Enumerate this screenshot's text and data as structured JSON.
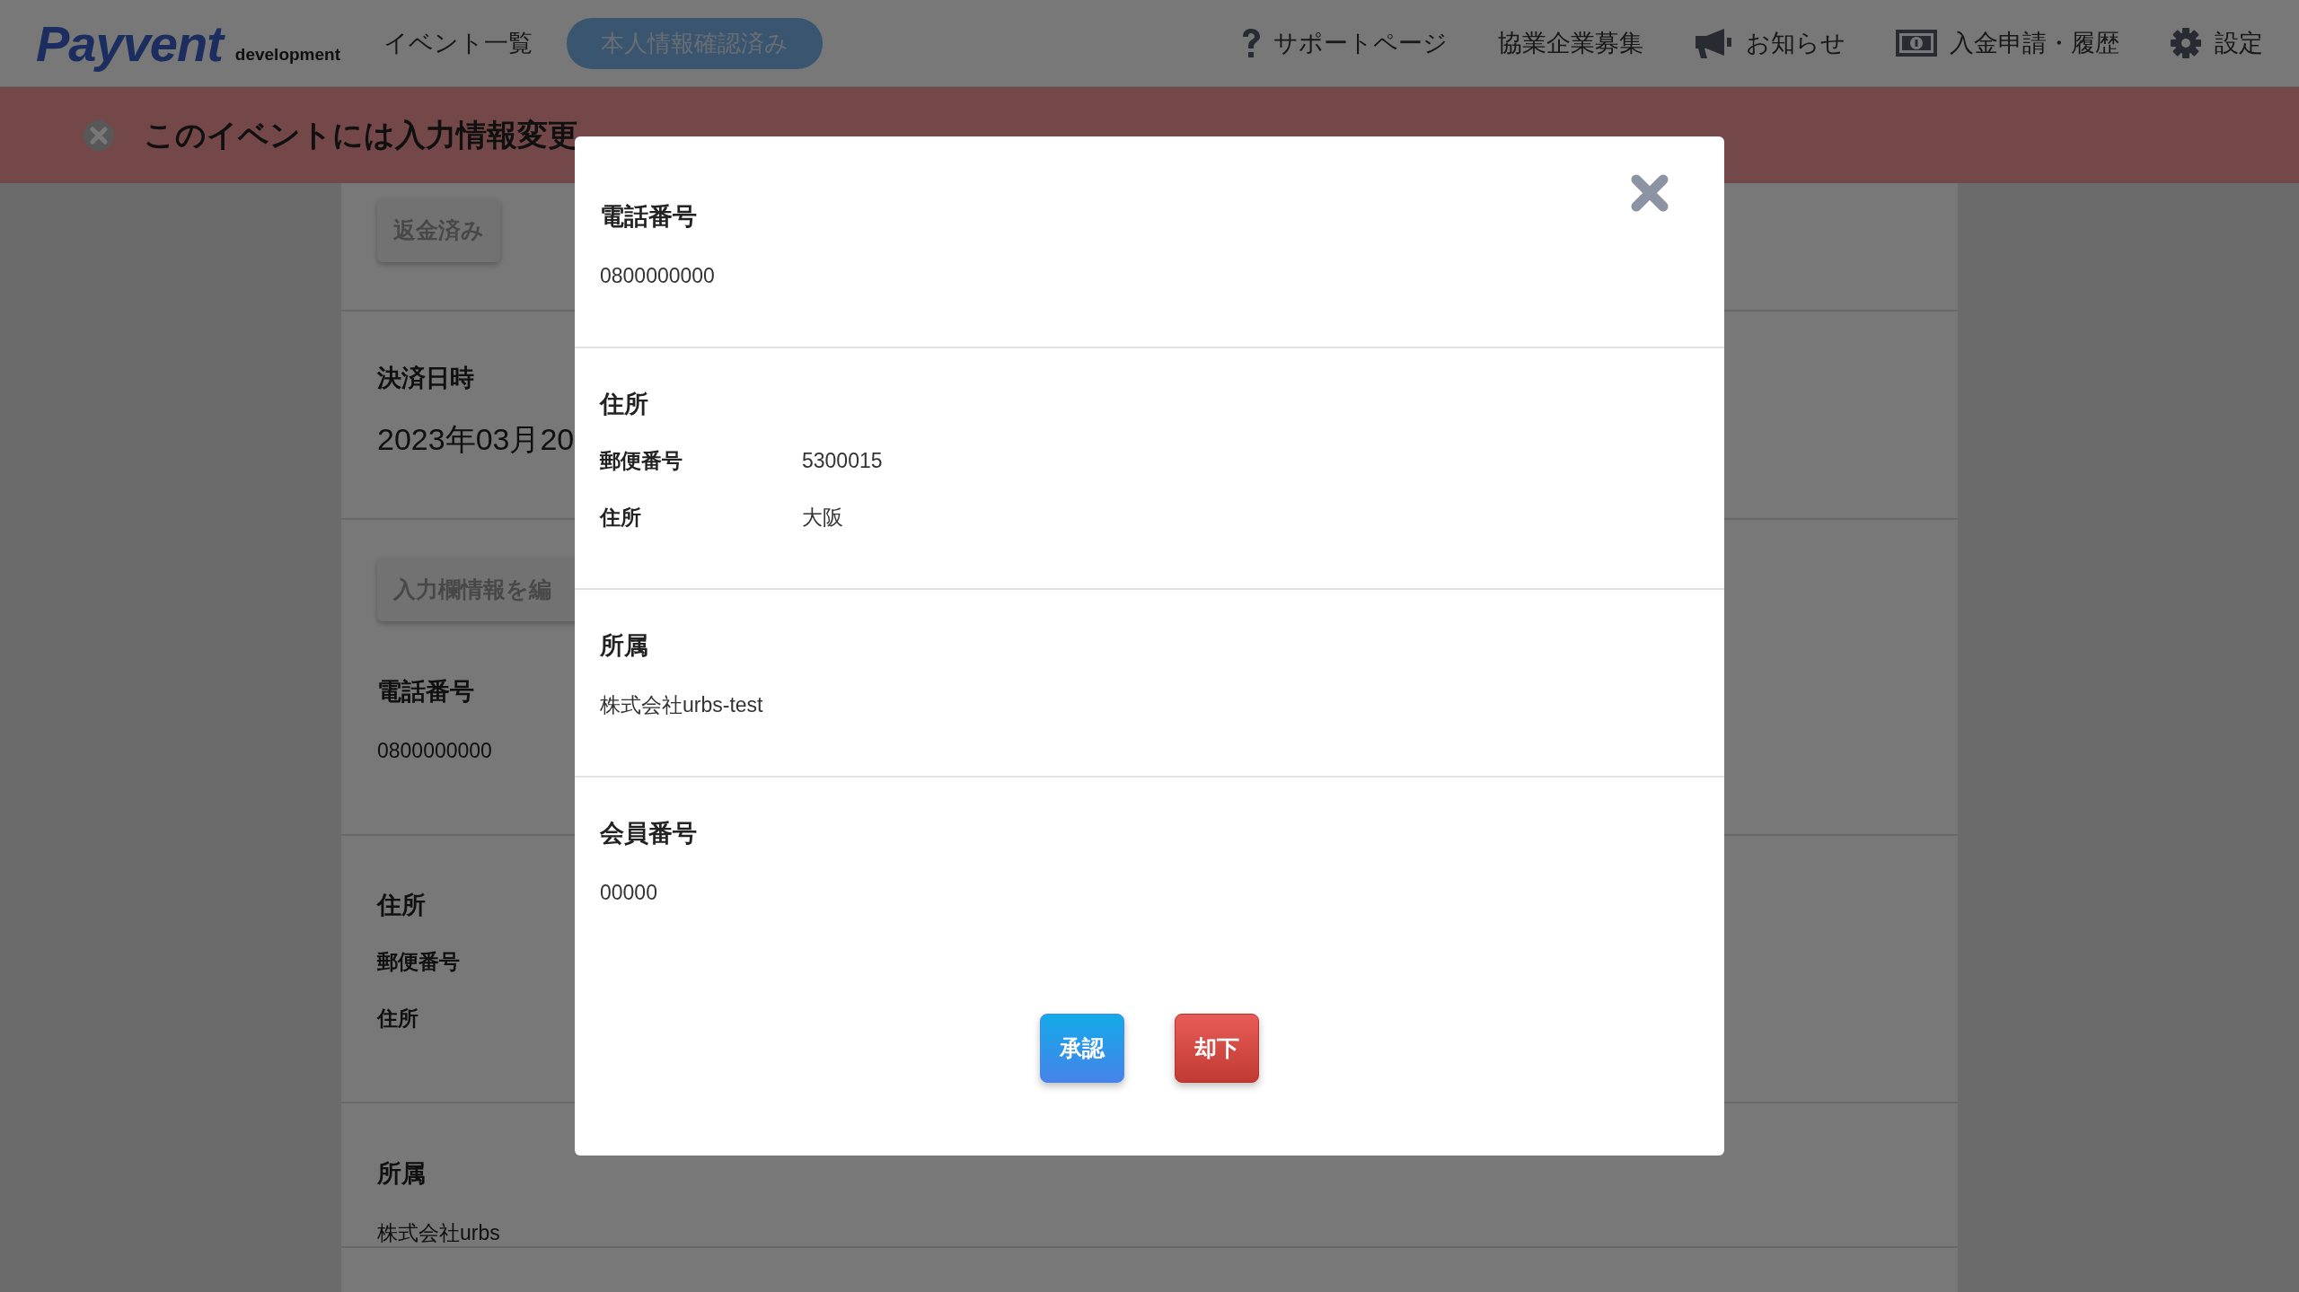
{
  "header": {
    "logo": "Payvent",
    "environment": "development",
    "nav_left": [
      {
        "label": "イベント一覧"
      }
    ],
    "verified_badge": "本人情報確認済み",
    "nav_right": [
      {
        "label": "サポートページ"
      },
      {
        "label": "協業企業募集"
      },
      {
        "label": "お知らせ"
      },
      {
        "label": "入金申請・履歴"
      },
      {
        "label": "設定"
      }
    ]
  },
  "alert": {
    "message": "このイベントには入力情報変更"
  },
  "background_card": {
    "sections": [
      {
        "items": [
          {
            "kind": "button",
            "label": "返金済み"
          }
        ]
      },
      {
        "items": [
          {
            "kind": "date",
            "label": "決済日時",
            "value": "2023年03月20"
          }
        ]
      },
      {
        "items": [
          {
            "kind": "button",
            "label": "入力欄情報を編"
          },
          {
            "kind": "field",
            "label": "電話番号",
            "value": "0800000000"
          }
        ]
      },
      {
        "items": [
          {
            "kind": "group",
            "label": "住所",
            "rows": [
              {
                "label": "郵便番号"
              },
              {
                "label": "住所"
              }
            ]
          }
        ]
      },
      {
        "items": [
          {
            "kind": "field",
            "label": "所属",
            "value": "株式会社urbs"
          }
        ]
      }
    ]
  },
  "modal": {
    "sections": [
      {
        "kind": "field",
        "label": "電話番号",
        "value": "0800000000"
      },
      {
        "kind": "group",
        "label": "住所",
        "rows": [
          {
            "label": "郵便番号",
            "value": "5300015"
          },
          {
            "label": "住所",
            "value": "大阪"
          }
        ]
      },
      {
        "kind": "field",
        "label": "所属",
        "value": "株式会社urbs-test"
      },
      {
        "kind": "field",
        "label": "会員番号",
        "value": "00000"
      }
    ],
    "buttons": [
      {
        "kind": "approve",
        "label": "承認"
      },
      {
        "kind": "reject",
        "label": "却下"
      }
    ]
  }
}
